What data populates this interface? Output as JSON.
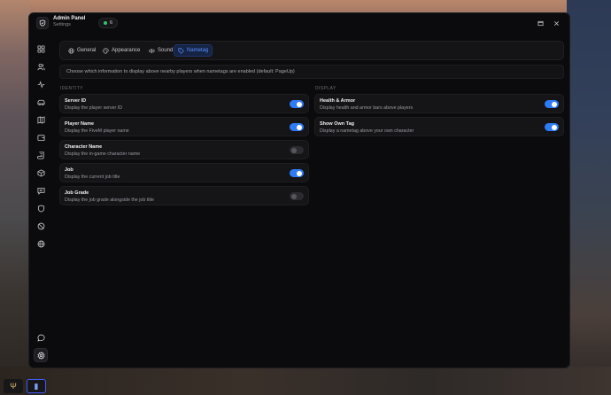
{
  "header": {
    "title": "Admin Panel",
    "subtitle": "Settings",
    "badge_count": "6",
    "badge_dot_color": "#32c46a"
  },
  "window_controls": [
    "maximize-icon",
    "close-icon"
  ],
  "sidebar": {
    "items": [
      {
        "icon": "dashboard-icon"
      },
      {
        "icon": "users-icon"
      },
      {
        "icon": "activity-icon"
      },
      {
        "icon": "vehicle-icon"
      },
      {
        "icon": "map-icon"
      },
      {
        "icon": "wallet-icon"
      },
      {
        "icon": "scroll-icon"
      },
      {
        "icon": "box-icon"
      },
      {
        "icon": "chat-list-icon"
      },
      {
        "icon": "shield-icon"
      },
      {
        "icon": "ban-icon"
      },
      {
        "icon": "globe-icon"
      }
    ],
    "bottom_items": [
      {
        "icon": "message-icon"
      },
      {
        "icon": "settings-icon",
        "active": true
      }
    ]
  },
  "tabs": [
    {
      "label": "General",
      "icon": "globe-icon",
      "active": false
    },
    {
      "label": "Appearance",
      "icon": "palette-icon",
      "active": false
    },
    {
      "label": "Sound",
      "icon": "speaker-icon",
      "active": false
    },
    {
      "label": "Nametag",
      "icon": "tag-icon",
      "active": true
    }
  ],
  "info_text": "Choose which information to display above nearby players when nametags are enabled (default: PageUp)",
  "sections": {
    "identity": {
      "label": "IDENTITY",
      "items": [
        {
          "name": "Server ID",
          "desc": "Display the player server ID",
          "enabled": true
        },
        {
          "name": "Player Name",
          "desc": "Display the FiveM player name",
          "enabled": true
        },
        {
          "name": "Character Name",
          "desc": "Display the in-game character name",
          "enabled": false
        },
        {
          "name": "Job",
          "desc": "Display the current job title",
          "enabled": true
        },
        {
          "name": "Job Grade",
          "desc": "Display the job grade alongside the job title",
          "enabled": false
        }
      ]
    },
    "display": {
      "label": "DISPLAY",
      "items": [
        {
          "name": "Health & Armor",
          "desc": "Display health and armor bars above players",
          "enabled": true
        },
        {
          "name": "Show Own Tag",
          "desc": "Display a nametag above your own character",
          "enabled": true
        }
      ]
    }
  },
  "colors": {
    "accent": "#2f7bf6",
    "window_bg": "#0b0b0d",
    "card_bg": "#151518"
  }
}
